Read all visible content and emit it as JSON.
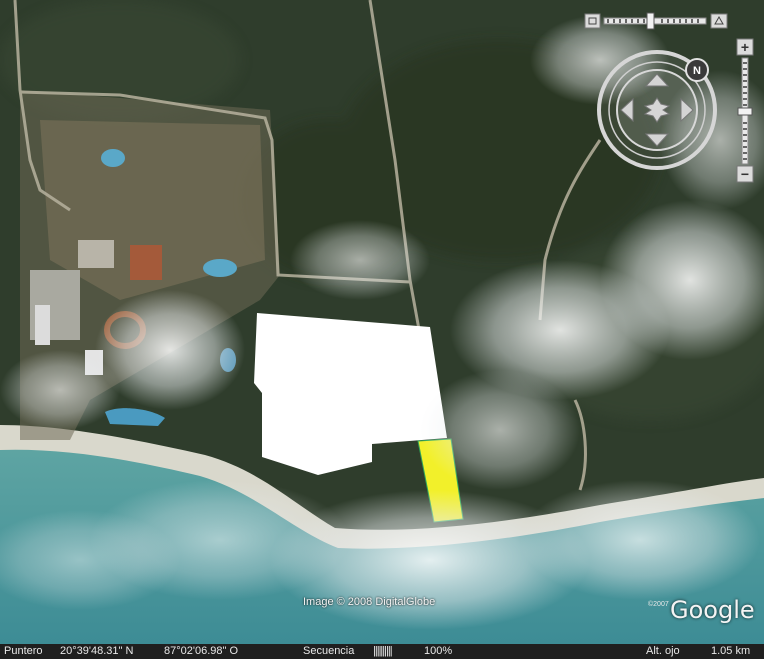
{
  "attribution": "Image © 2008 DigitalGlobe",
  "logo": {
    "text": "Google",
    "year": "©2007"
  },
  "status_bar": {
    "pointer_label": "Puntero",
    "latitude": "20°39'48.31\" N",
    "longitude": "87°02'06.98\" O",
    "stream_label": "Secuencia",
    "stream_bars": "||||||||||",
    "stream_percent": "100%",
    "eye_alt_label": "Alt. ojo",
    "eye_alt_value": "1.05 km"
  },
  "navigation": {
    "compass_label": "N",
    "zoom_in": "+",
    "zoom_out": "−",
    "tilt_level": 0.18,
    "zoom_level": 0.6
  },
  "colors": {
    "highlight_polygon": "#f2f02a",
    "masked_area": "#ffffff",
    "sea": "#4a9a9a",
    "forest": "#2f3d2c"
  }
}
